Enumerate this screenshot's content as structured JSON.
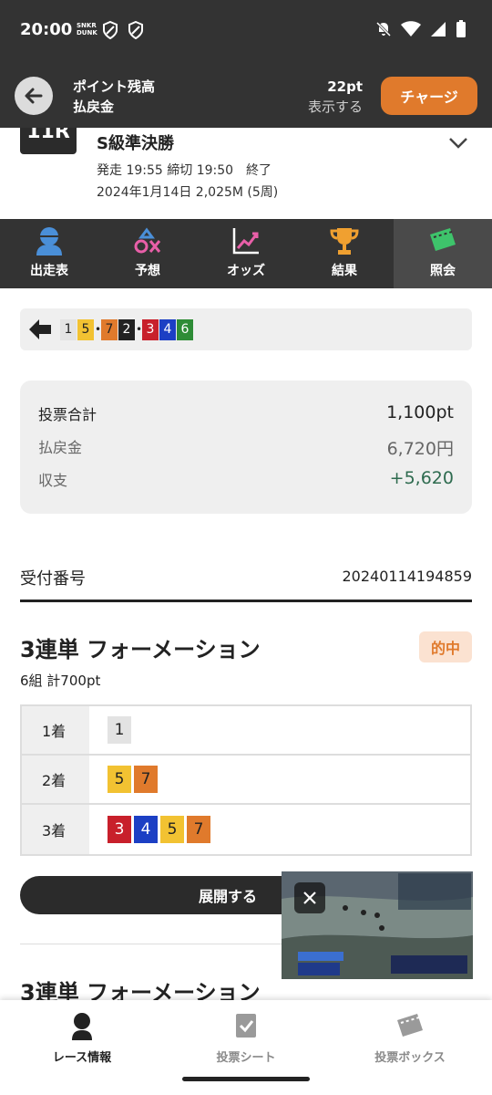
{
  "status_bar": {
    "time": "20:00",
    "mini_logo": "SNKR\nDUNK",
    "icons": [
      "shield-icon",
      "shield-icon",
      "bell-off-icon",
      "wifi-icon",
      "signal-icon",
      "battery-icon"
    ]
  },
  "header": {
    "title": "ポイント残高",
    "subtitle": "払戻金",
    "points": "22pt",
    "show_label": "表示する",
    "charge_label": "チャージ"
  },
  "race": {
    "badge": "11R",
    "title": "S級準決勝",
    "time_info": "発走 19:55 締切 19:50　終了",
    "date_info": "2024年1月14日 2,025M (5周)"
  },
  "tabs": [
    {
      "label": "出走表",
      "icon": "racer-icon"
    },
    {
      "label": "予想",
      "icon": "prediction-icon"
    },
    {
      "label": "オッズ",
      "icon": "chart-icon"
    },
    {
      "label": "結果",
      "icon": "trophy-icon"
    },
    {
      "label": "照会",
      "icon": "ticket-icon",
      "active": true
    }
  ],
  "result_order": [
    {
      "num": "1",
      "color": "c1"
    },
    {
      "num": "5",
      "color": "c5"
    },
    {
      "sep": "•"
    },
    {
      "num": "7",
      "color": "c7"
    },
    {
      "num": "2",
      "color": "c2"
    },
    {
      "sep": "•"
    },
    {
      "num": "3",
      "color": "c3"
    },
    {
      "num": "4",
      "color": "c4"
    },
    {
      "num": "6",
      "color": "c6"
    }
  ],
  "summary": {
    "total_label": "投票合計",
    "total_value": "1,100pt",
    "payout_label": "払戻金",
    "payout_value": "6,720円",
    "balance_label": "収支",
    "balance_value": "+5,620"
  },
  "receipt": {
    "label": "受付番号",
    "number": "20240114194859"
  },
  "bet": {
    "title": "3連単 フォーメーション",
    "hit_label": "的中",
    "subtitle": "6組 計700pt",
    "rows": [
      {
        "label": "1着",
        "nums": [
          {
            "n": "1",
            "c": "c1"
          }
        ]
      },
      {
        "label": "2着",
        "nums": [
          {
            "n": "5",
            "c": "c5"
          },
          {
            "n": "7",
            "c": "c7"
          }
        ]
      },
      {
        "label": "3着",
        "nums": [
          {
            "n": "3",
            "c": "c3"
          },
          {
            "n": "4",
            "c": "c4"
          },
          {
            "n": "5",
            "c": "c5"
          },
          {
            "n": "7",
            "c": "c7"
          }
        ]
      }
    ],
    "expand_label": "展開する"
  },
  "bet2": {
    "title": "3連単 フォーメーション"
  },
  "bottom_nav": [
    {
      "label": "レース情報",
      "icon": "racer-icon",
      "active": true
    },
    {
      "label": "投票シート",
      "icon": "check-sheet-icon"
    },
    {
      "label": "投票ボックス",
      "icon": "ticket-box-icon"
    }
  ],
  "colors": {
    "accent": "#e07a2c",
    "dark": "#333333",
    "positive": "#2e6b4f"
  }
}
